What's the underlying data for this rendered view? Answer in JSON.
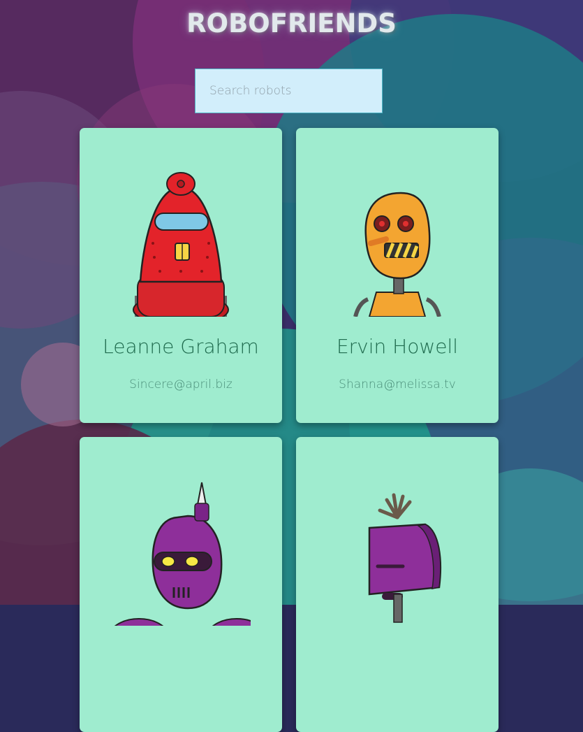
{
  "header": {
    "title": "ROBOFRIENDS"
  },
  "search": {
    "placeholder": "Search robots",
    "value": ""
  },
  "robots": [
    {
      "name": "Leanne Graham",
      "email": "Sincere@april.biz",
      "color": "#e3232a"
    },
    {
      "name": "Ervin Howell",
      "email": "Shanna@melissa.tv",
      "color": "#f3a531"
    },
    {
      "name": "",
      "email": "",
      "color": "#8e2f9a"
    },
    {
      "name": "",
      "email": "",
      "color": "#8e2f9a"
    }
  ],
  "theme": {
    "card_bg": "#9feccf",
    "name_color": "#1f6b4e",
    "search_bg": "#d2eefb"
  }
}
